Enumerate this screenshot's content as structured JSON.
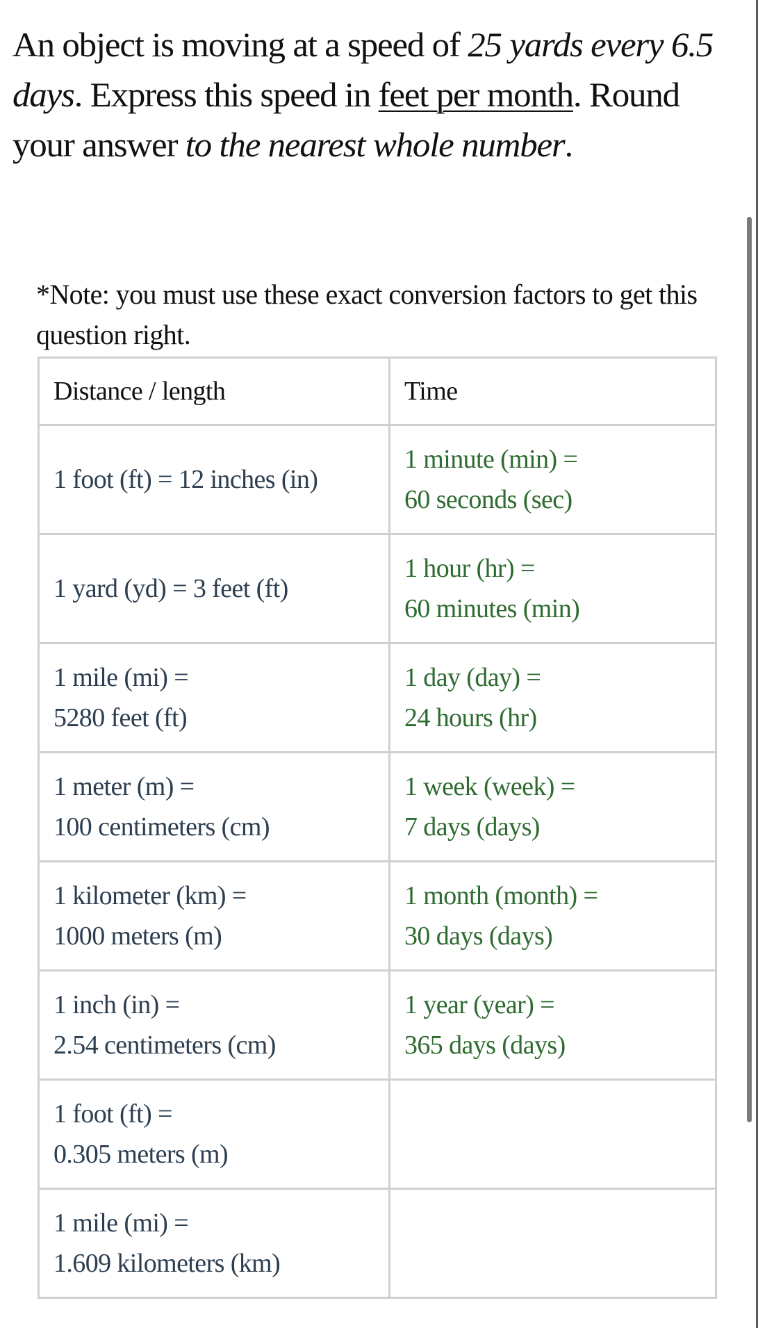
{
  "question": {
    "segments": [
      {
        "text": "An object is moving at a speed of ",
        "style": "normal"
      },
      {
        "text": "25 yards every 6.5 days",
        "style": "italic"
      },
      {
        "text": ". Express this speed in ",
        "style": "normal"
      },
      {
        "text": "feet per month",
        "style": "underline"
      },
      {
        "text": ". Round your answer ",
        "style": "normal"
      },
      {
        "text": "to the nearest whole number",
        "style": "italic"
      },
      {
        "text": ".",
        "style": "normal"
      }
    ]
  },
  "note": "*Note: you must use these exact conversion factors to get this question right.",
  "table": {
    "headers": [
      "Distance / length",
      "Time"
    ],
    "rows": [
      {
        "distance": [
          "1 foot (ft) = 12 inches (in)"
        ],
        "time": [
          "1 minute (min) =",
          "60 seconds (sec)"
        ]
      },
      {
        "distance": [
          "1 yard (yd) = 3 feet (ft)"
        ],
        "time": [
          "1 hour (hr) =",
          "60 minutes (min)"
        ]
      },
      {
        "distance": [
          "1 mile (mi) =",
          "5280 feet (ft)"
        ],
        "time": [
          "1 day (day) =",
          "24 hours (hr)"
        ]
      },
      {
        "distance": [
          "1 meter (m) =",
          "100 centimeters (cm)"
        ],
        "time": [
          "1 week (week) =",
          "7 days (days)"
        ]
      },
      {
        "distance": [
          "1 kilometer (km) =",
          "1000 meters (m)"
        ],
        "time": [
          "1 month (month) =",
          "30 days (days)"
        ]
      },
      {
        "distance": [
          "1 inch (in) =",
          "2.54 centimeters (cm)"
        ],
        "time": [
          "1 year (year) =",
          "365 days (days)"
        ]
      },
      {
        "distance": [
          "1 foot (ft) =",
          "0.305 meters (m)"
        ],
        "time": []
      },
      {
        "distance": [
          "1 mile (mi) =",
          "1.609 kilometers (km)"
        ],
        "time": []
      }
    ]
  },
  "colors": {
    "distance_text": "#2c3e50",
    "time_text": "#2e6b30",
    "border": "#d0d0d0"
  }
}
